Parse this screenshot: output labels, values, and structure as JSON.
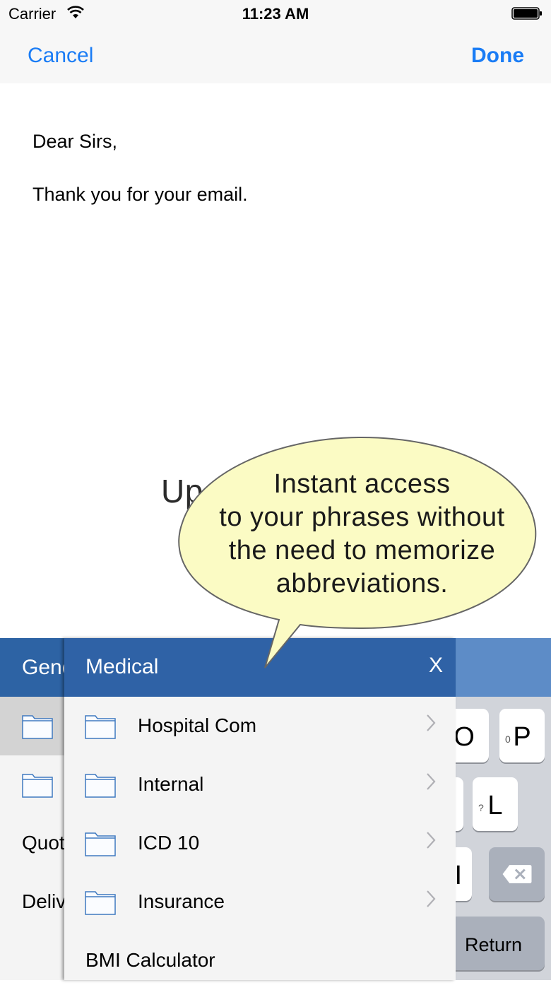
{
  "status_bar": {
    "carrier": "Carrier",
    "time": "11:23 AM"
  },
  "nav": {
    "cancel_label": "Cancel",
    "done_label": "Done"
  },
  "email": {
    "lines": [
      "Dear Sirs,",
      "Thank you for your email."
    ]
  },
  "watermark": "UpdateStar.com",
  "bubble": {
    "lines": [
      "Instant access",
      "to your phrases without",
      "the need to memorize",
      "abbreviations."
    ]
  },
  "left_panel": {
    "title": "General",
    "rows": [
      "",
      "",
      "Quotes",
      "Delivery"
    ]
  },
  "medical_panel": {
    "title": "Medical",
    "close_label": "X",
    "rows": [
      "Hospital Com",
      "Internal",
      "ICD 10",
      "Insurance",
      "BMI Calculator"
    ]
  },
  "keyboard": {
    "keys": {
      "o": "O",
      "p": "P",
      "p_hint": "0",
      "l": "L",
      "l_hint": "?",
      "i_partial": "I",
      "return": "Return"
    }
  },
  "colors": {
    "accent": "#1a7cf5",
    "panel_header": "#2f62a6",
    "bubble_fill": "#fbfbc4"
  }
}
